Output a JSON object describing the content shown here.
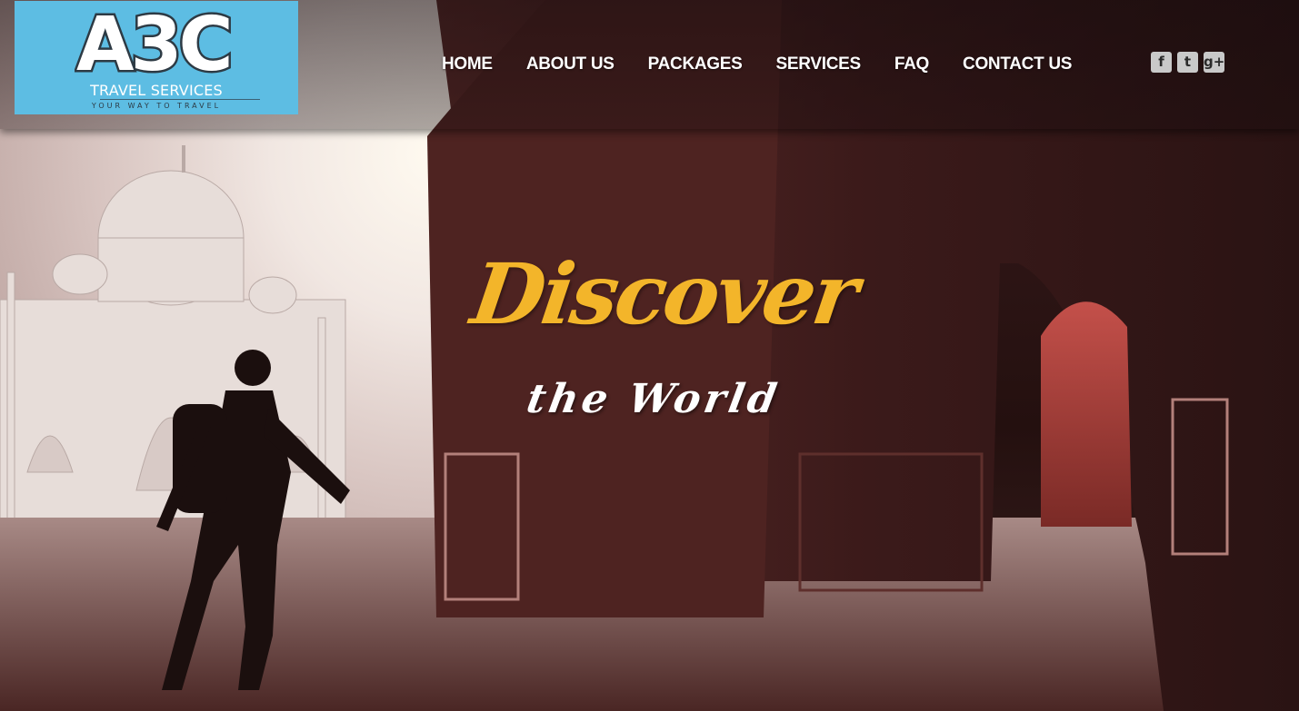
{
  "brand": {
    "logo_text": "A3C",
    "name": "TRAVEL SERVICES",
    "tagline": "YOUR WAY TO TRAVEL",
    "logo_bg_color": "#5dbde3"
  },
  "nav": {
    "items": [
      {
        "label": "HOME"
      },
      {
        "label": "ABOUT US"
      },
      {
        "label": "PACKAGES"
      },
      {
        "label": "SERVICES"
      },
      {
        "label": "FAQ"
      },
      {
        "label": "CONTACT US"
      }
    ]
  },
  "social": {
    "icons": [
      {
        "icon": "facebook-icon",
        "glyph": "f"
      },
      {
        "icon": "twitter-icon",
        "glyph": "t"
      },
      {
        "icon": "google-plus-icon",
        "glyph": "g+"
      }
    ]
  },
  "hero": {
    "headline_primary": "Discover",
    "headline_secondary": "the World",
    "accent_color": "#f3b52a",
    "image_subject": "traveler-walking-by-arch-with-domed-monument"
  }
}
